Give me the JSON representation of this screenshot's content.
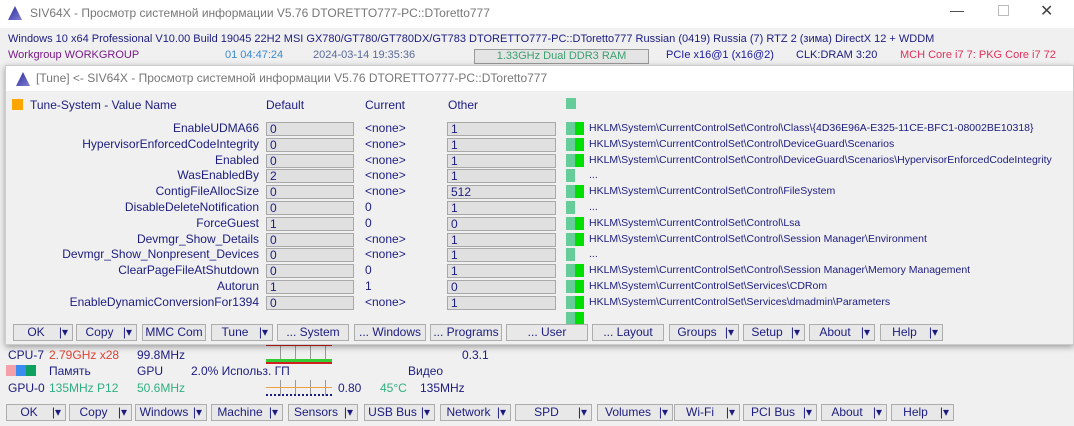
{
  "window": {
    "title": "SIV64X - Просмотр системной информации V5.76 DTORETTO777-PC::DToretto777"
  },
  "info": {
    "os": "Windows 10 x64 Professional  V10.00  Build 19045  22H2  MSI GX780/GT780/GT780DX/GT783  DTORETTO777-PC::DToretto777  Russian (0419)  Russia (7)  RTZ 2 (зима)  DirectX 12 + WDDM",
    "workgroup": "Workgroup WORKGROUP",
    "uptime": "01 04:47:24",
    "datetime": "2024-03-14 19:35:36",
    "memory": "1.33GHz Dual DDR3 RAM",
    "pcie": "PCIe x16@1 (x16@2)",
    "clk": "CLK:DRAM 3:20",
    "temps": "MCH Core i7 7: PKG Core i7 72"
  },
  "child": {
    "title": "[Tune] <- SIV64X - Просмотр системной информации V5.76 DTORETTO777-PC::DToretto777",
    "headers": {
      "name": "Tune-System - Value Name",
      "default": "Default",
      "current": "Current",
      "other": "Other"
    },
    "rows": [
      {
        "name": "EnableUDMA66",
        "default": "0",
        "current": "<none>",
        "other": "1",
        "path": "HKLM\\System\\CurrentControlSet\\Control\\Class\\{4D36E96A-E325-11CE-BFC1-08002BE10318}",
        "on": true
      },
      {
        "name": "HypervisorEnforcedCodeIntegrity",
        "default": "0",
        "current": "<none>",
        "other": "1",
        "path": "HKLM\\System\\CurrentControlSet\\Control\\DeviceGuard\\Scenarios",
        "on": true
      },
      {
        "name": "Enabled",
        "default": "0",
        "current": "<none>",
        "other": "1",
        "path": "HKLM\\System\\CurrentControlSet\\Control\\DeviceGuard\\Scenarios\\HypervisorEnforcedCodeIntegrity",
        "on": true
      },
      {
        "name": "WasEnabledBy",
        "default": "2",
        "current": "<none>",
        "other": "1",
        "path": "...",
        "on": false
      },
      {
        "name": "ContigFileAllocSize",
        "default": "0",
        "current": "<none>",
        "other": "512",
        "path": "HKLM\\System\\CurrentControlSet\\Control\\FileSystem",
        "on": true
      },
      {
        "name": "DisableDeleteNotification",
        "default": "0",
        "current": "0",
        "other": "1",
        "path": "...",
        "on": false
      },
      {
        "name": "ForceGuest",
        "default": "1",
        "current": "0",
        "other": "0",
        "path": "HKLM\\System\\CurrentControlSet\\Control\\Lsa",
        "on": true
      },
      {
        "name": "Devmgr_Show_Details",
        "default": "0",
        "current": "<none>",
        "other": "1",
        "path": "HKLM\\System\\CurrentControlSet\\Control\\Session Manager\\Environment",
        "on": true
      },
      {
        "name": "Devmgr_Show_Nonpresent_Devices",
        "default": "0",
        "current": "<none>",
        "other": "1",
        "path": "...",
        "on": false
      },
      {
        "name": "ClearPageFileAtShutdown",
        "default": "0",
        "current": "0",
        "other": "1",
        "path": "HKLM\\System\\CurrentControlSet\\Control\\Session Manager\\Memory Management",
        "on": true
      },
      {
        "name": "Autorun",
        "default": "1",
        "current": "1",
        "other": "0",
        "path": "HKLM\\System\\CurrentControlSet\\Services\\CDRom",
        "on": true
      },
      {
        "name": "EnableDynamicConversionFor1394",
        "default": "0",
        "current": "<none>",
        "other": "1",
        "path": "HKLM\\System\\CurrentControlSet\\Services\\dmadmin\\Parameters",
        "on": true
      }
    ],
    "buttons": [
      {
        "label": "OK",
        "dd": true
      },
      {
        "label": "Copy",
        "dd": true
      },
      {
        "label": "MMC Com",
        "dd": false
      },
      {
        "label": "Tune",
        "dd": true
      },
      {
        "label": "... System",
        "dd": false
      },
      {
        "label": "... Windows",
        "dd": false
      },
      {
        "label": "... Programs",
        "dd": false
      },
      {
        "label": "... User",
        "dd": false
      },
      {
        "label": "... Layout",
        "dd": false
      },
      {
        "label": "Groups",
        "dd": true
      },
      {
        "label": "Setup",
        "dd": true
      },
      {
        "label": "About",
        "dd": true
      },
      {
        "label": "Help",
        "dd": true
      }
    ]
  },
  "status": {
    "cpu_label": "CPU-7",
    "cpu_freq": "2.79GHz x28",
    "bus": "99.8MHz",
    "version": "0.3.1",
    "mem_label": "Память",
    "gpu_label": "GPU",
    "gpu_use": "2.0% Использ. ГП",
    "video_label": "Видео",
    "gpu0": "GPU-0",
    "gpu_clock": "135MHz P12",
    "gpu_mem": "50.6MHz",
    "gpu_volt": "0.80",
    "gpu_temp": "45°C",
    "video_clock": "135MHz"
  },
  "bottom_buttons": [
    {
      "label": "OK"
    },
    {
      "label": "Copy"
    },
    {
      "label": "Windows"
    },
    {
      "label": "Machine"
    },
    {
      "label": "Sensors"
    },
    {
      "label": "USB Bus"
    },
    {
      "label": "Network"
    },
    {
      "label": "SPD"
    },
    {
      "label": "Volumes"
    },
    {
      "label": "Wi-Fi"
    },
    {
      "label": "PCI Bus"
    },
    {
      "label": "About"
    },
    {
      "label": "Help"
    }
  ],
  "colors": {
    "text": "#1c1c80",
    "green": "#00e000",
    "teal": "#66cc99",
    "orange": "#ffa500",
    "red": "#e0303a"
  }
}
